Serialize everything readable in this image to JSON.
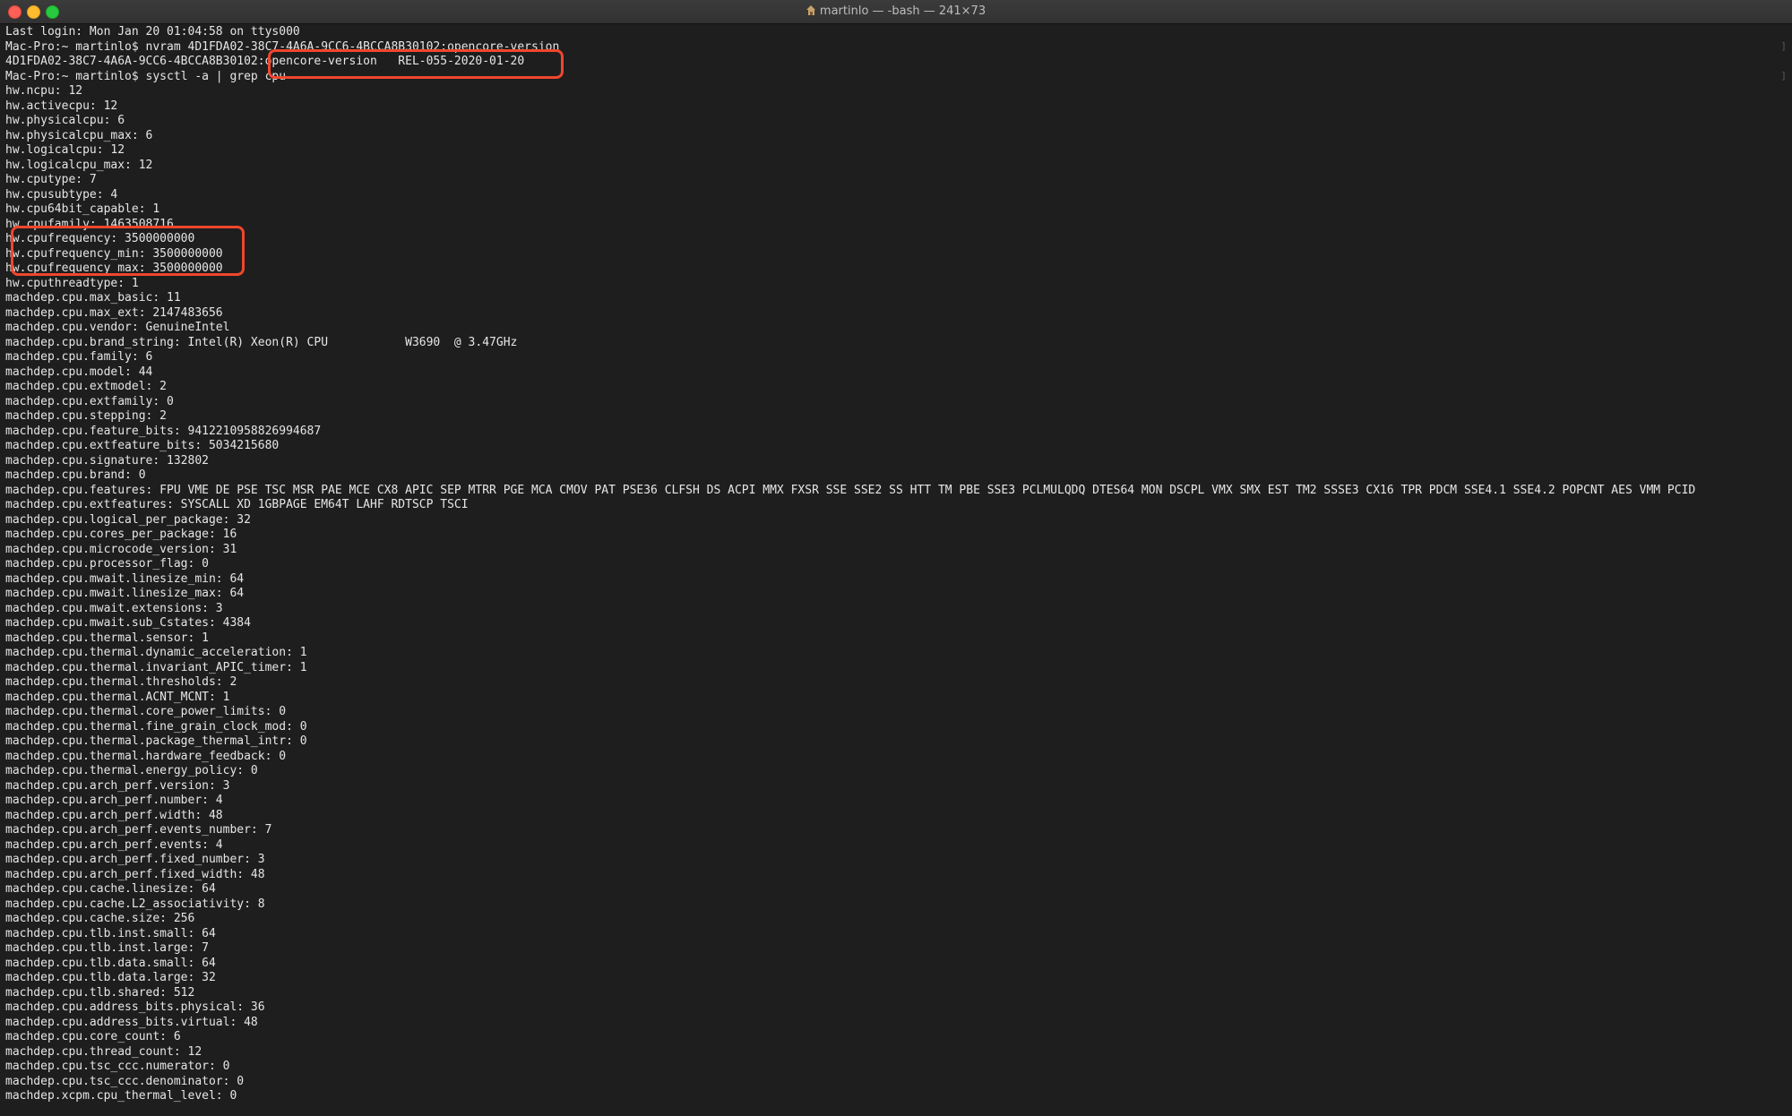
{
  "window": {
    "title": "martinlo — -bash — 241×73"
  },
  "terminal": {
    "lines": [
      "Last login: Mon Jan 20 01:04:58 on ttys000",
      "Mac-Pro:~ martinlo$ nvram 4D1FDA02-38C7-4A6A-9CC6-4BCCA8B30102:opencore-version",
      "4D1FDA02-38C7-4A6A-9CC6-4BCCA8B30102:opencore-version\tREL-055-2020-01-20",
      "Mac-Pro:~ martinlo$ sysctl -a | grep cpu",
      "hw.ncpu: 12",
      "hw.activecpu: 12",
      "hw.physicalcpu: 6",
      "hw.physicalcpu_max: 6",
      "hw.logicalcpu: 12",
      "hw.logicalcpu_max: 12",
      "hw.cputype: 7",
      "hw.cpusubtype: 4",
      "hw.cpu64bit_capable: 1",
      "hw.cpufamily: 1463508716",
      "hw.cpufrequency: 3500000000",
      "hw.cpufrequency_min: 3500000000",
      "hw.cpufrequency_max: 3500000000",
      "hw.cputhreadtype: 1",
      "machdep.cpu.max_basic: 11",
      "machdep.cpu.max_ext: 2147483656",
      "machdep.cpu.vendor: GenuineIntel",
      "machdep.cpu.brand_string: Intel(R) Xeon(R) CPU           W3690  @ 3.47GHz",
      "machdep.cpu.family: 6",
      "machdep.cpu.model: 44",
      "machdep.cpu.extmodel: 2",
      "machdep.cpu.extfamily: 0",
      "machdep.cpu.stepping: 2",
      "machdep.cpu.feature_bits: 9412210958826994687",
      "machdep.cpu.extfeature_bits: 5034215680",
      "machdep.cpu.signature: 132802",
      "machdep.cpu.brand: 0",
      "machdep.cpu.features: FPU VME DE PSE TSC MSR PAE MCE CX8 APIC SEP MTRR PGE MCA CMOV PAT PSE36 CLFSH DS ACPI MMX FXSR SSE SSE2 SS HTT TM PBE SSE3 PCLMULQDQ DTES64 MON DSCPL VMX SMX EST TM2 SSSE3 CX16 TPR PDCM SSE4.1 SSE4.2 POPCNT AES VMM PCID",
      "machdep.cpu.extfeatures: SYSCALL XD 1GBPAGE EM64T LAHF RDTSCP TSCI",
      "machdep.cpu.logical_per_package: 32",
      "machdep.cpu.cores_per_package: 16",
      "machdep.cpu.microcode_version: 31",
      "machdep.cpu.processor_flag: 0",
      "machdep.cpu.mwait.linesize_min: 64",
      "machdep.cpu.mwait.linesize_max: 64",
      "machdep.cpu.mwait.extensions: 3",
      "machdep.cpu.mwait.sub_Cstates: 4384",
      "machdep.cpu.thermal.sensor: 1",
      "machdep.cpu.thermal.dynamic_acceleration: 1",
      "machdep.cpu.thermal.invariant_APIC_timer: 1",
      "machdep.cpu.thermal.thresholds: 2",
      "machdep.cpu.thermal.ACNT_MCNT: 1",
      "machdep.cpu.thermal.core_power_limits: 0",
      "machdep.cpu.thermal.fine_grain_clock_mod: 0",
      "machdep.cpu.thermal.package_thermal_intr: 0",
      "machdep.cpu.thermal.hardware_feedback: 0",
      "machdep.cpu.thermal.energy_policy: 0",
      "machdep.cpu.arch_perf.version: 3",
      "machdep.cpu.arch_perf.number: 4",
      "machdep.cpu.arch_perf.width: 48",
      "machdep.cpu.arch_perf.events_number: 7",
      "machdep.cpu.arch_perf.events: 4",
      "machdep.cpu.arch_perf.fixed_number: 3",
      "machdep.cpu.arch_perf.fixed_width: 48",
      "machdep.cpu.cache.linesize: 64",
      "machdep.cpu.cache.L2_associativity: 8",
      "machdep.cpu.cache.size: 256",
      "machdep.cpu.tlb.inst.small: 64",
      "machdep.cpu.tlb.inst.large: 7",
      "machdep.cpu.tlb.data.small: 64",
      "machdep.cpu.tlb.data.large: 32",
      "machdep.cpu.tlb.shared: 512",
      "machdep.cpu.address_bits.physical: 36",
      "machdep.cpu.address_bits.virtual: 48",
      "machdep.cpu.core_count: 6",
      "machdep.cpu.thread_count: 12",
      "machdep.cpu.tsc_ccc.numerator: 0",
      "machdep.cpu.tsc_ccc.denominator: 0",
      "machdep.xcpm.cpu_thermal_level: 0"
    ]
  },
  "colors": {
    "background": "#1e1e1e",
    "text": "#e6e6e6",
    "highlight": "#f0462c"
  }
}
